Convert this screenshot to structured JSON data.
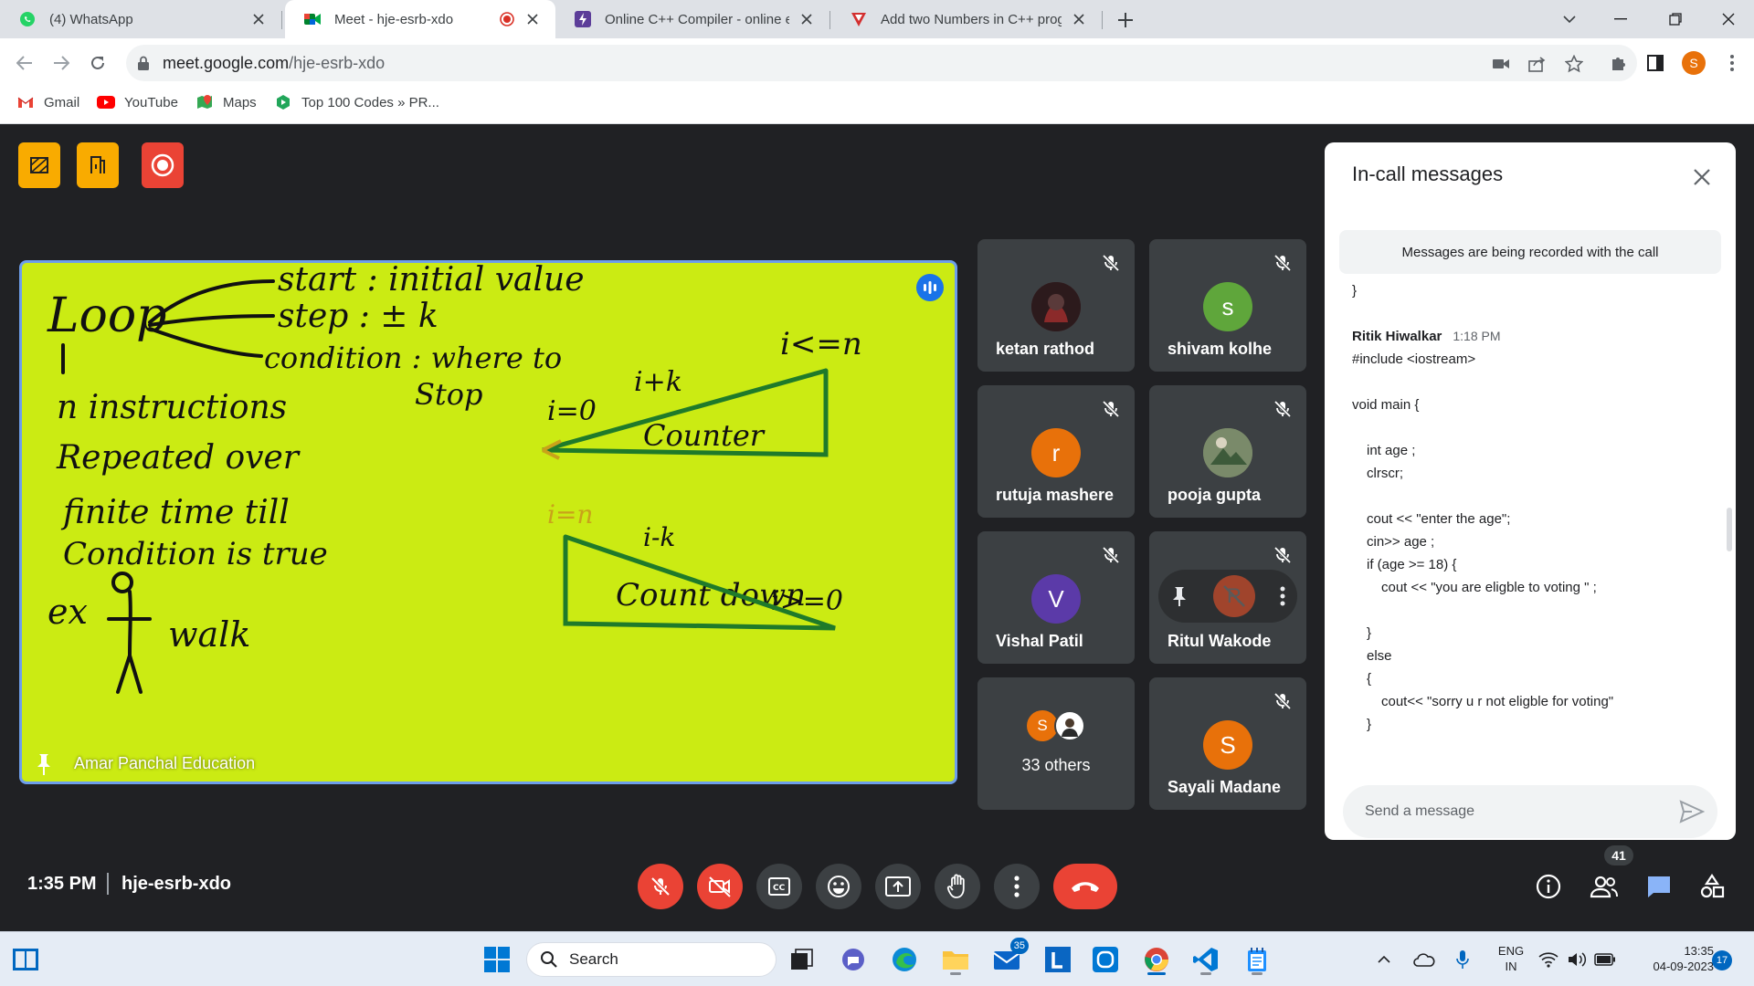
{
  "browser": {
    "tabs": [
      {
        "title": "(4) WhatsApp",
        "icon": "whatsapp-icon"
      },
      {
        "title": "Meet - hje-esrb-xdo",
        "icon": "google-meet-icon",
        "active": true,
        "recording": true
      },
      {
        "title": "Online C++ Compiler - online ed",
        "icon": "onlinegdb-icon"
      },
      {
        "title": "Add two Numbers in C++ progra",
        "icon": "vertex-icon"
      }
    ],
    "url_domain": "meet.google.com",
    "url_path": "/hje-esrb-xdo",
    "profile_initial": "S",
    "bookmarks": [
      "Gmail",
      "YouTube",
      "Maps",
      "Top 100 Codes » PR..."
    ]
  },
  "presentation": {
    "presenter": "Amar Panchal Education",
    "board_text": {
      "loop": "Loop",
      "start": "start : initial value",
      "step": "step : ± k",
      "condition": "condition : where to",
      "stop": "Stop",
      "n_instructions": "n instructions",
      "repeated": "Repeated over",
      "finite": "finite time till",
      "cond_true": "Condition is true",
      "ex": "ex",
      "walk": "walk",
      "i_le_n": "i<=n",
      "i_plus_k": "i+k",
      "i_eq_0": "i=0",
      "counter": "Counter",
      "i_eq_n": "i=n",
      "i_minus_k": "i-k",
      "i_ge_0": "i>=0",
      "countdown": "Count down"
    }
  },
  "participants": [
    {
      "name": "ketan rathod",
      "initial": "",
      "color": "#4a2226",
      "muted": true
    },
    {
      "name": "shivam kolhe",
      "initial": "s",
      "color": "#5fa63b",
      "muted": true
    },
    {
      "name": "rutuja mashere",
      "initial": "r",
      "color": "#e8710a",
      "muted": true
    },
    {
      "name": "pooja gupta",
      "initial": "",
      "color": "#6e7b5a",
      "muted": true
    },
    {
      "name": "Vishal Patil",
      "initial": "V",
      "color": "#5b3aa8",
      "muted": true
    },
    {
      "name": "Ritul Wakode",
      "initial": "R",
      "color": "#a0442c",
      "muted": true
    },
    {
      "name": "33 others",
      "initial": "S",
      "color": "#e8710a"
    },
    {
      "name": "Sayali Madane",
      "initial": "S",
      "color": "#e8710a",
      "muted": true
    }
  ],
  "chat": {
    "title": "In-call messages",
    "notice": "Messages are being recorded with the call",
    "lines": [
      {
        "text": "}",
        "indent": 0
      },
      {
        "text": "",
        "indent": 0
      },
      {
        "sender": "Ritik Hiwalkar",
        "time": "1:18 PM"
      },
      {
        "text": "#include <iostream>",
        "indent": 0
      },
      {
        "text": "",
        "indent": 0
      },
      {
        "text": "void main {",
        "indent": 0
      },
      {
        "text": "",
        "indent": 0
      },
      {
        "text": "int age ;",
        "indent": 1
      },
      {
        "text": "clrscr;",
        "indent": 1
      },
      {
        "text": "",
        "indent": 0
      },
      {
        "text": "cout << \"enter the age\";",
        "indent": 1
      },
      {
        "text": "cin>> age ;",
        "indent": 1
      },
      {
        "text": "if (age >= 18) {",
        "indent": 1
      },
      {
        "text": "cout << \"you are eligble to voting \" ;",
        "indent": 2
      },
      {
        "text": "",
        "indent": 0
      },
      {
        "text": "}",
        "indent": 1
      },
      {
        "text": "else",
        "indent": 1
      },
      {
        "text": "{",
        "indent": 1
      },
      {
        "text": "cout<< \"sorry u r not eligble for voting\"",
        "indent": 2
      },
      {
        "text": "}",
        "indent": 1
      }
    ],
    "input_placeholder": "Send a message"
  },
  "meeting": {
    "time": "1:35 PM",
    "code": "hje-esrb-xdo",
    "people_count": "41"
  },
  "taskbar": {
    "search_placeholder": "Search",
    "mail_badge": "35",
    "lang_line1": "ENG",
    "lang_line2": "IN",
    "clock_time": "13:35",
    "clock_date": "04-09-2023",
    "notif_count": "17"
  }
}
